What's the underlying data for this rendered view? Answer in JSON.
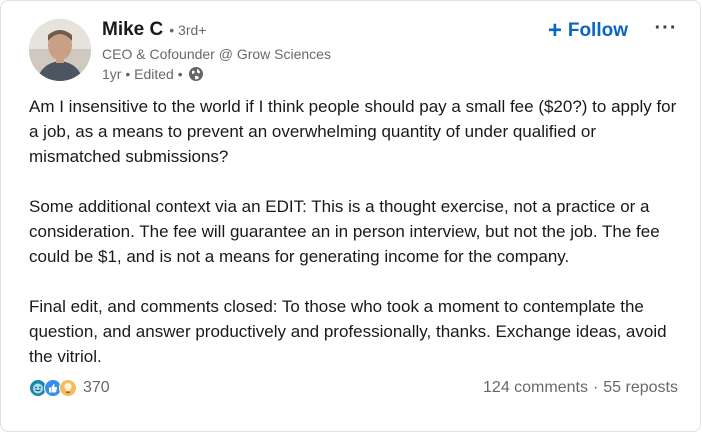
{
  "post": {
    "author": {
      "name": "Mike C",
      "degree": "• 3rd+",
      "headline": "CEO & Cofounder @ Grow Sciences",
      "time": "1yr • Edited •"
    },
    "actions": {
      "follow_label": "Follow",
      "follow_icon": "+",
      "more_label": "···"
    },
    "body": {
      "paragraphs": [
        "Am I insensitive to the world if I think people should pay a small fee ($20?) to apply for a job, as a means to prevent an overwhelming quantity of under qualified or mismatched submissions?",
        "Some additional context via an EDIT: This is a thought exercise, not a practice or a consideration. The fee will guarantee an in person interview, but not the job. The fee could be $1, and is not a means for generating income for the company.",
        "Final edit, and comments closed: To those who took a moment to contemplate the question, and answer productively and professionally, thanks. Exchange ideas, avoid the vitriol."
      ]
    },
    "social": {
      "reaction_icons": [
        "funny-icon",
        "like-icon",
        "insightful-icon"
      ],
      "reaction_count": "370",
      "comments": "124 comments",
      "separator": "·",
      "reposts": "55 reposts"
    }
  },
  "colors": {
    "link_blue": "#0a66c2",
    "text_primary": "rgba(0,0,0,0.9)",
    "text_secondary": "rgba(0,0,0,0.6)",
    "border": "#e0dfdc"
  }
}
